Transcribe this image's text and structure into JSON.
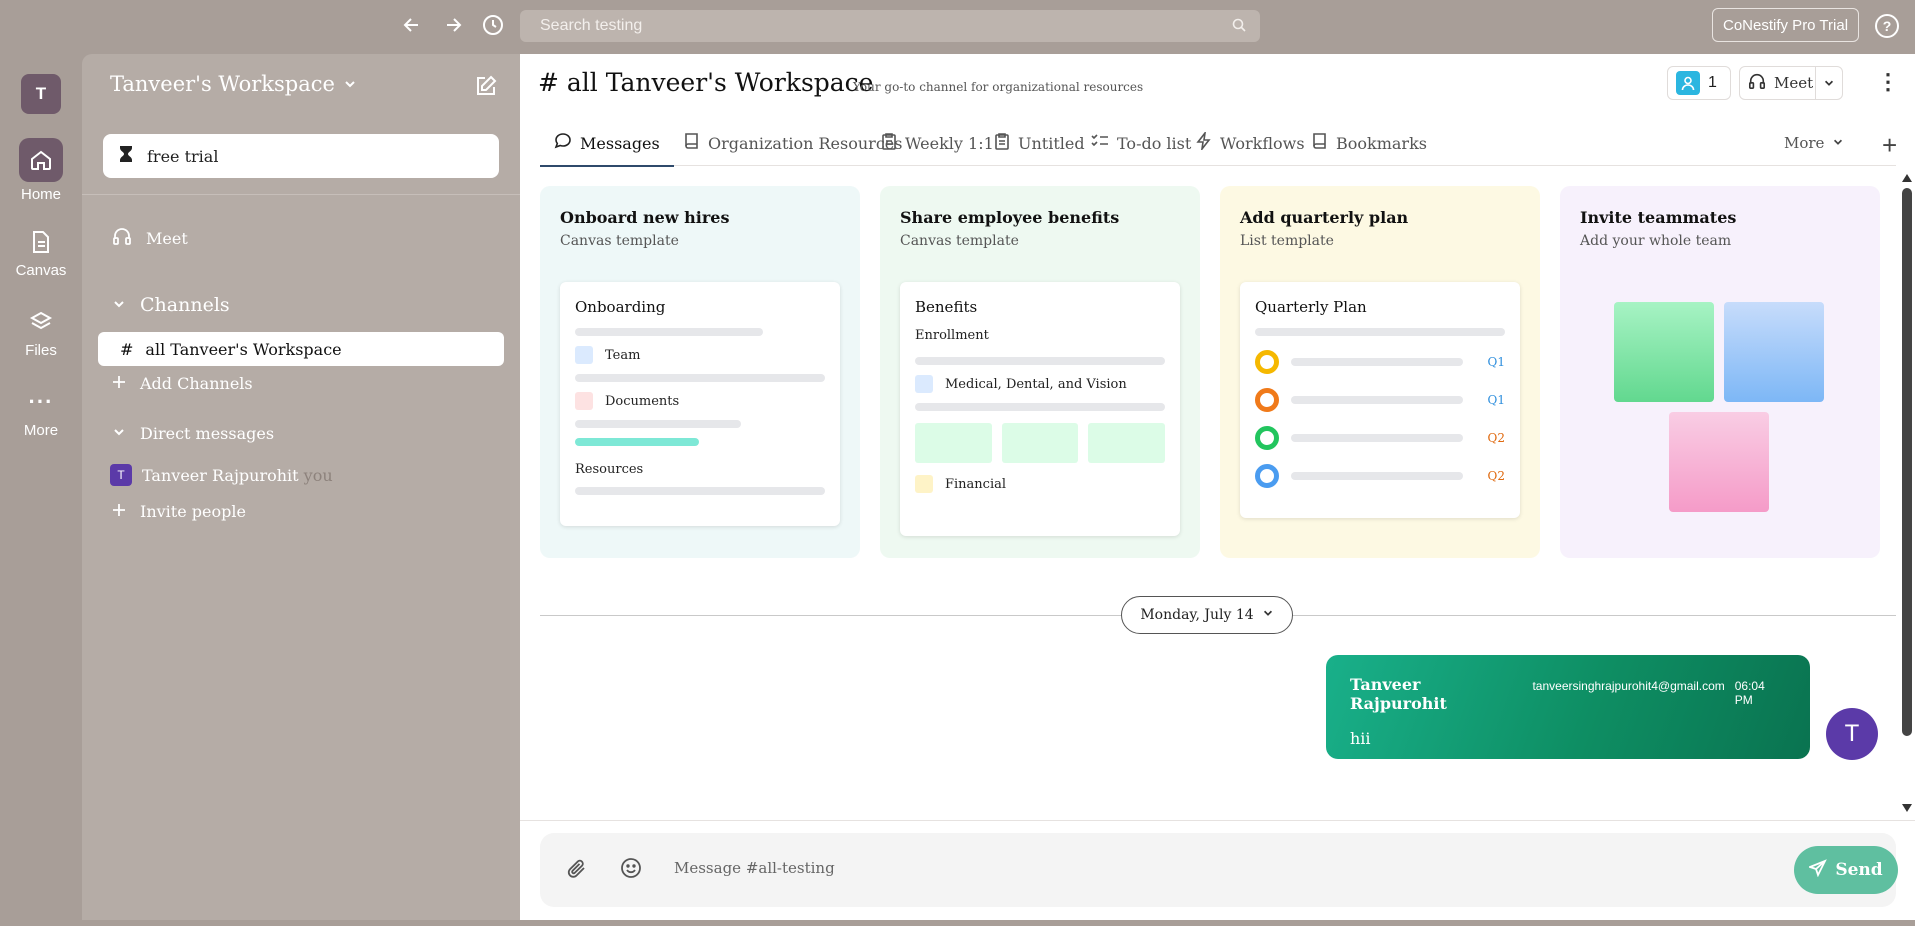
{
  "topbar": {
    "search_placeholder": "Search testing",
    "trial_button": "CoNestify Pro Trial",
    "help_label": "?"
  },
  "rail": {
    "workspace_initial": "T",
    "items": [
      {
        "label": "Home",
        "icon": "home-icon",
        "active": true
      },
      {
        "label": "Canvas",
        "icon": "document-icon"
      },
      {
        "label": "Files",
        "icon": "layers-icon"
      },
      {
        "label": "More",
        "icon": "more-icon"
      }
    ]
  },
  "sidebar": {
    "workspace_name": "Tanveer's Workspace",
    "free_trial": "free trial",
    "meet": "Meet",
    "channels_header": "Channels",
    "channel_active_hash": "#",
    "channel_active": "all Tanveer's Workspace",
    "add_channels": "Add Channels",
    "dm_header": "Direct messages",
    "dm_user_initial": "T",
    "dm_user": "Tanveer Rajpurohit",
    "dm_you": "you",
    "invite": "Invite people"
  },
  "channel": {
    "title": "# all Tanveer's Workspace",
    "description": "Your go-to channel for organizational resources",
    "member_count": "1",
    "meet_label": "Meet"
  },
  "tabs": [
    {
      "label": "Messages",
      "icon": "chat-bubble-icon",
      "active": true
    },
    {
      "label": "Organization Resources",
      "icon": "book-icon"
    },
    {
      "label": "Weekly 1:1",
      "icon": "clipboard-icon"
    },
    {
      "label": "Untitled",
      "icon": "clipboard-icon"
    },
    {
      "label": "To-do list",
      "icon": "checklist-icon"
    },
    {
      "label": "Workflows",
      "icon": "lightning-icon"
    },
    {
      "label": "Bookmarks",
      "icon": "bookmark-icon"
    }
  ],
  "tabs_more": "More",
  "templates": {
    "onboard": {
      "title": "Onboard new hires",
      "subtitle": "Canvas template",
      "inner_title": "Onboarding",
      "rows": [
        "Team",
        "Documents",
        "Resources"
      ]
    },
    "benefits": {
      "title": "Share employee benefits",
      "subtitle": "Canvas template",
      "inner_title": "Benefits",
      "section": "Enrollment",
      "rows": [
        "Medical, Dental, and Vision",
        "Financial"
      ]
    },
    "quarterly": {
      "title": "Add quarterly plan",
      "subtitle": "List template",
      "inner_title": "Quarterly Plan",
      "items": [
        {
          "tag": "Q1",
          "color": "#f5b800",
          "tag_color": "#2f8fdd"
        },
        {
          "tag": "Q1",
          "color": "#f07a1a",
          "tag_color": "#2f8fdd"
        },
        {
          "tag": "Q2",
          "color": "#22c55e",
          "tag_color": "#e06a10"
        },
        {
          "tag": "Q2",
          "color": "#4a9cf0",
          "tag_color": "#e06a10"
        }
      ]
    },
    "invite": {
      "title": "Invite teammates",
      "subtitle": "Add your whole team"
    }
  },
  "date_divider": "Monday, July 14",
  "message": {
    "author": "Tanveer Rajpurohit",
    "email": "tanveersinghrajpurohit4@gmail.com",
    "time": "06:04 PM",
    "text": "hii",
    "avatar_initial": "T"
  },
  "composer": {
    "placeholder": "Message #all-testing",
    "send_label": "Send"
  },
  "colors": {
    "accent": "#6f5a6a",
    "message_bubble": "#0e8e63",
    "send_button": "#5fbfa0",
    "avatar": "#5b3aa8"
  }
}
